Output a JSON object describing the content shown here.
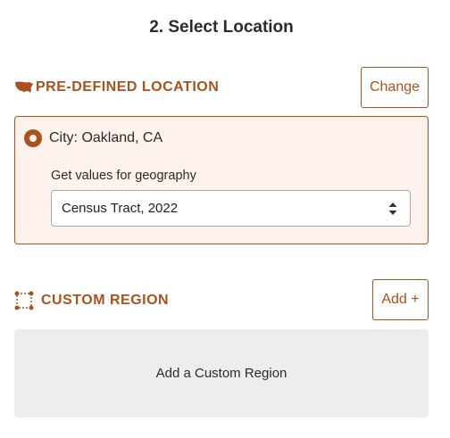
{
  "page": {
    "title": "2. Select Location"
  },
  "predefined": {
    "heading": "PRE-DEFINED LOCATION",
    "icon": "usa-map-icon",
    "change_label": "Change",
    "selected_city": "City: Oakland, CA",
    "geography_label": "Get values for geography",
    "geography_value": "Census Tract, 2022"
  },
  "custom": {
    "heading": "CUSTOM REGION",
    "icon": "polygon-region-icon",
    "add_label": "Add +",
    "placeholder": "Add a Custom Region"
  },
  "colors": {
    "accent": "#a8521d",
    "panel_bg": "#fdf3ec",
    "placeholder_bg": "#ededed"
  }
}
